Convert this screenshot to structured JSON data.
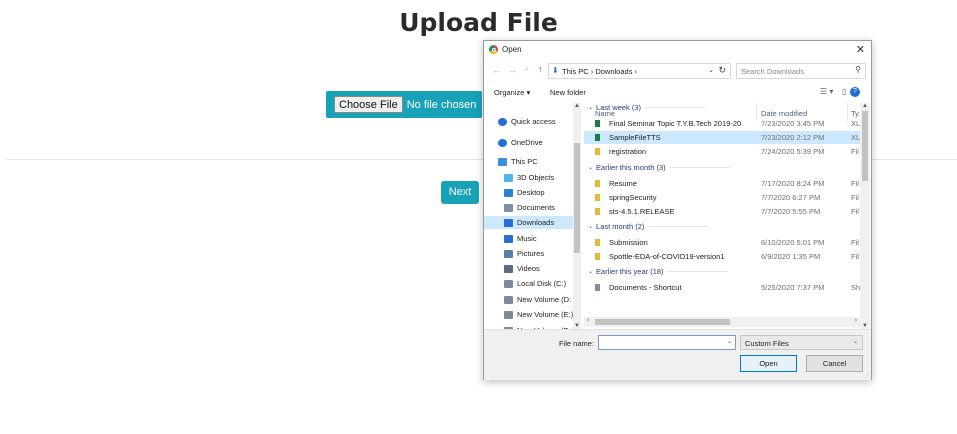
{
  "page": {
    "title": "Upload File",
    "choose_file_label": "Choose File",
    "no_file_text": "No file chosen",
    "next_label": "Next",
    "accent_color": "#17a2b8"
  },
  "dialog": {
    "title": "Open",
    "close_glyph": "✕",
    "nav": {
      "back": "←",
      "forward": "→",
      "recent": "⌄",
      "up": "↑"
    },
    "breadcrumb": "This PC  ›  Downloads  ›",
    "search_placeholder": "Search Downloads",
    "toolbar": {
      "organize": "Organize ▾",
      "new_folder": "New folder",
      "help": "?"
    },
    "sidebar": [
      {
        "label": "Quick access",
        "icon": "pin-icon"
      },
      {
        "label": "OneDrive",
        "icon": "cloud-icon"
      },
      {
        "label": "This PC",
        "icon": "computer-icon"
      },
      {
        "label": "3D Objects",
        "icon": "cube-icon"
      },
      {
        "label": "Desktop",
        "icon": "desktop-icon"
      },
      {
        "label": "Documents",
        "icon": "documents-icon"
      },
      {
        "label": "Downloads",
        "icon": "download-icon",
        "selected": true
      },
      {
        "label": "Music",
        "icon": "music-icon"
      },
      {
        "label": "Pictures",
        "icon": "pictures-icon"
      },
      {
        "label": "Videos",
        "icon": "videos-icon"
      },
      {
        "label": "Local Disk (C:)",
        "icon": "drive-icon"
      },
      {
        "label": "New Volume (D:",
        "icon": "drive-icon"
      },
      {
        "label": "New Volume (E:)",
        "icon": "drive-icon"
      },
      {
        "label": "New Volume (F:",
        "icon": "drive-icon"
      }
    ],
    "columns": {
      "name": "Name",
      "date": "Date modified",
      "type": "Ty"
    },
    "groups": [
      {
        "label": "Last week (3)",
        "files": [
          {
            "name": "Final Seminar Topic T.Y.B.Tech 2019-20",
            "date": "7/23/2020 3:45 PM",
            "type": "XL",
            "icon": "excel-file-icon"
          },
          {
            "name": "SampleFileTTS",
            "date": "7/23/2020 2:12 PM",
            "type": "XL",
            "icon": "excel-file-icon",
            "selected": true
          },
          {
            "name": "registration",
            "date": "7/24/2020 5:39 PM",
            "type": "Fil",
            "icon": "folder-icon"
          }
        ]
      },
      {
        "label": "Earlier this month (3)",
        "files": [
          {
            "name": "Resume",
            "date": "7/17/2020 8:24 PM",
            "type": "Fil",
            "icon": "folder-icon"
          },
          {
            "name": "springSecurity",
            "date": "7/7/2020 6:27 PM",
            "type": "Fil",
            "icon": "folder-icon"
          },
          {
            "name": "sts-4.5.1.RELEASE",
            "date": "7/7/2020 5:55 PM",
            "type": "Fil",
            "icon": "folder-icon"
          }
        ]
      },
      {
        "label": "Last month (2)",
        "files": [
          {
            "name": "Submission",
            "date": "6/10/2020 5:01 PM",
            "type": "Fil",
            "icon": "folder-icon"
          },
          {
            "name": "Spottle-EDA-of-COVID19-version1",
            "date": "6/9/2020 1:35 PM",
            "type": "Fil",
            "icon": "folder-icon"
          }
        ]
      },
      {
        "label": "Earlier this year (18)",
        "files": [
          {
            "name": "Documents - Shortcut",
            "date": "5/25/2020 7:37 PM",
            "type": "Sh",
            "icon": "shortcut-icon"
          }
        ]
      }
    ],
    "file_name_label": "File name:",
    "file_name_value": "",
    "filter_value": "Custom Files",
    "open_label": "Open",
    "cancel_label": "Cancel"
  }
}
